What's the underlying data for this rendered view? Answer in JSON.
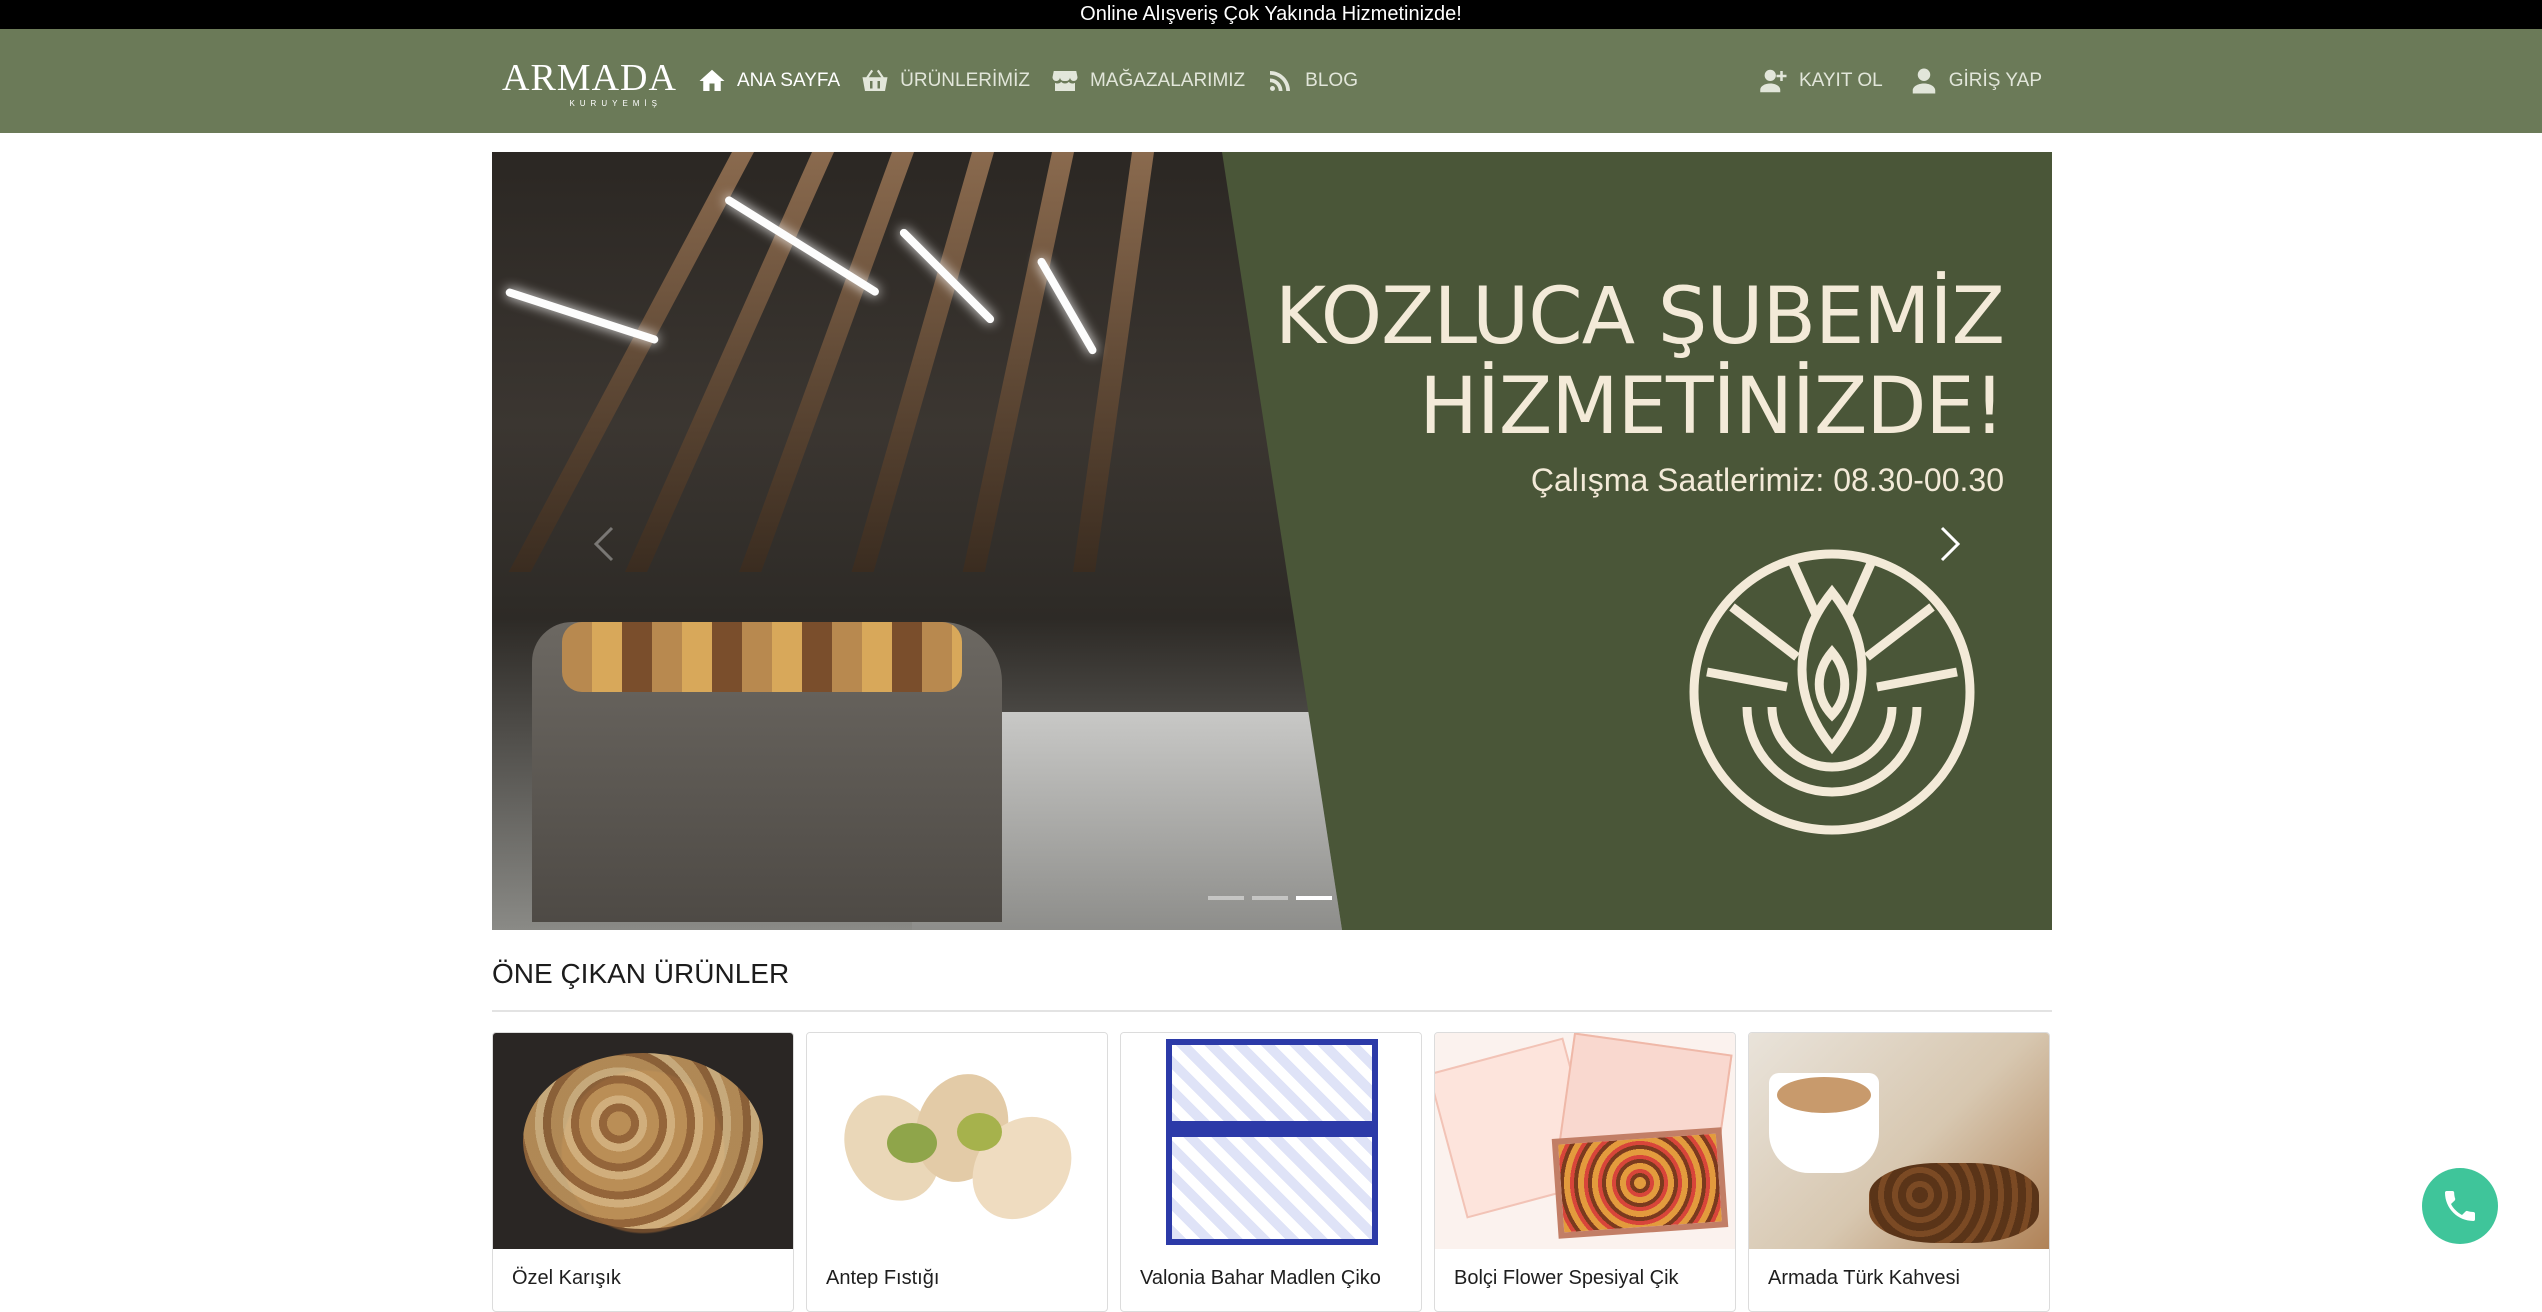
{
  "announcement": "Online Alışveriş Çok Yakında Hizmetinizde!",
  "brand": {
    "name": "ARMADA",
    "sub": "KURUYEMİŞ"
  },
  "nav": [
    {
      "label": "ANA SAYFA",
      "icon": "home-icon",
      "active": true
    },
    {
      "label": "ÜRÜNLERİMİZ",
      "icon": "basket-icon",
      "active": false
    },
    {
      "label": "MAĞAZALARIMIZ",
      "icon": "store-icon",
      "active": false
    },
    {
      "label": "BLOG",
      "icon": "blog-icon",
      "active": false
    }
  ],
  "auth": {
    "register": "KAYIT OL",
    "login": "GİRİŞ YAP"
  },
  "slider": {
    "headline_1": "KOZLUCA ŞUBEMİZ",
    "headline_2": "HİZMETİNİZDE!",
    "hours": "Çalışma Saatlerimiz: 08.30-00.30",
    "slide_count": 3,
    "active_slide": 3,
    "panel_color": "#4a5638"
  },
  "featured": {
    "title": "ÖNE ÇIKAN ÜRÜNLER",
    "products": [
      {
        "name": "Özel Karışık"
      },
      {
        "name": "Antep Fıstığı"
      },
      {
        "name": "Valonia Bahar Madlen Çiko"
      },
      {
        "name": "Bolçi Flower Spesiyal Çik"
      },
      {
        "name": "Armada Türk Kahvesi"
      }
    ]
  },
  "colors": {
    "header": "#6b7a58",
    "accent_phone": "#3fc59a"
  }
}
